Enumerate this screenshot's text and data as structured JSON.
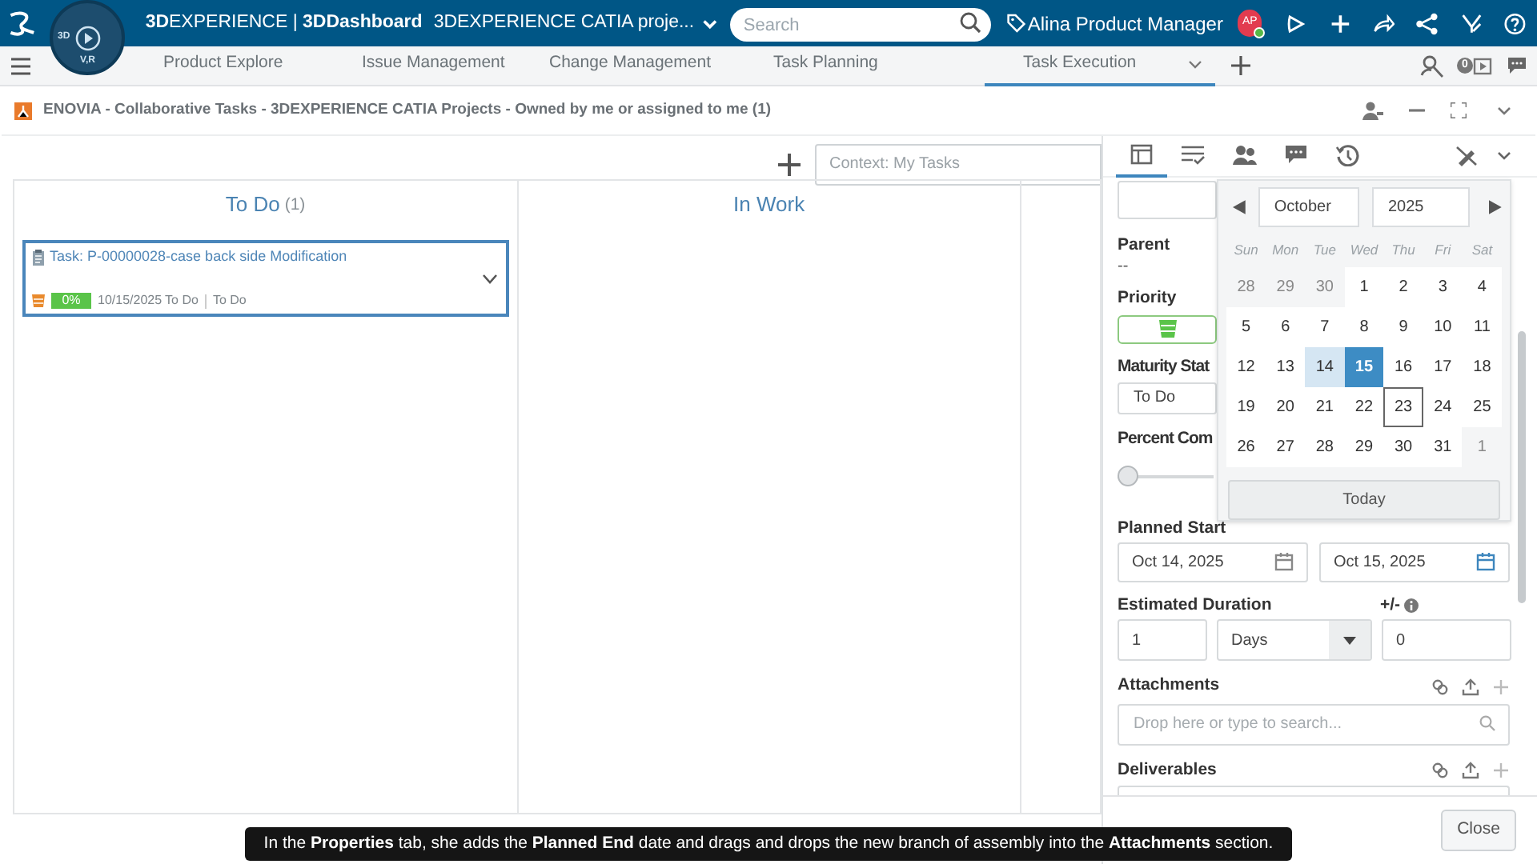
{
  "top_bar": {
    "compass_labels": [
      "3D",
      "V,R"
    ],
    "title": "**3D**EXPERIENCE | **3DDashboard**",
    "dashboard": "3DEXPERIENCE CATIA proje...",
    "search": {
      "placeholder": "Search"
    },
    "user": "Alina Product Manager",
    "avatar": "AP"
  },
  "tabs": [
    {
      "label": "Product Explore",
      "selected": false
    },
    {
      "label": "Issue Management",
      "selected": false
    },
    {
      "label": "Change Management",
      "selected": false
    },
    {
      "label": "Task Planning",
      "selected": false
    },
    {
      "label": "Task Execution",
      "selected": true
    }
  ],
  "notifications_count": "0",
  "widget_title": "ENOVIA - Collaborative Tasks - 3DEXPERIENCE CATIA Projects - Owned by me or assigned to me (1)",
  "context": {
    "placeholder": "Context: My Tasks"
  },
  "columns": [
    {
      "title": "To Do",
      "count": "(1)",
      "cards": [
        {
          "title": "Task: P-00000028-case back side Modification",
          "progress": "0%",
          "date": "10/15/2025",
          "state": "To Do",
          "state_2": "To Do"
        }
      ]
    },
    {
      "title": "In Work"
    }
  ],
  "panel": {
    "tabs": [
      {
        "kind": "properties",
        "selected": true
      },
      {
        "kind": "checklist",
        "selected": false
      },
      {
        "kind": "members",
        "selected": false
      },
      {
        "kind": "comments",
        "selected": false
      },
      {
        "kind": "history",
        "selected": false
      }
    ],
    "parent_label": "Parent",
    "parent_value": "--",
    "priority_label": "Priority",
    "maturity_label": "Maturity Stat",
    "maturity_value": "To Do",
    "percent_label": "Percent Com",
    "percent": {
      "level": 0
    },
    "planned_start_label": "Planned Start",
    "start_date": "Oct 14, 2025",
    "end_date": "Oct 15, 2025",
    "duration_label": "Estimated Duration",
    "tolerance_label": "+/-",
    "duration": "1",
    "unit": "Days",
    "tolerance": "0",
    "attachments_label": "Attachments",
    "attachments_placeholder": "Drop here or type to search...",
    "deliverables_label": "Deliverables",
    "close": "Close"
  },
  "calendar": {
    "month": "October",
    "year": "2025",
    "weekdays": [
      "Sun",
      "Mon",
      "Tue",
      "Wed",
      "Thu",
      "Fri",
      "Sat"
    ],
    "weeks": [
      [
        {
          "day": "28",
          "muted": true
        },
        {
          "day": "29",
          "muted": true
        },
        {
          "day": "30",
          "muted": true
        },
        {
          "day": "1"
        },
        {
          "day": "2"
        },
        {
          "day": "3"
        },
        {
          "day": "4"
        }
      ],
      [
        {
          "day": "5"
        },
        {
          "day": "6"
        },
        {
          "day": "7"
        },
        {
          "day": "8"
        },
        {
          "day": "9"
        },
        {
          "day": "10"
        },
        {
          "day": "11"
        }
      ],
      [
        {
          "day": "12"
        },
        {
          "day": "13"
        },
        {
          "day": "14",
          "in_range": true
        },
        {
          "day": "15",
          "selected": true
        },
        {
          "day": "16"
        },
        {
          "day": "17"
        },
        {
          "day": "18"
        }
      ],
      [
        {
          "day": "19"
        },
        {
          "day": "20"
        },
        {
          "day": "21"
        },
        {
          "day": "22"
        },
        {
          "day": "23",
          "hovered": true
        },
        {
          "day": "24"
        },
        {
          "day": "25"
        }
      ],
      [
        {
          "day": "26"
        },
        {
          "day": "27"
        },
        {
          "day": "28"
        },
        {
          "day": "29"
        },
        {
          "day": "30"
        },
        {
          "day": "31"
        },
        {
          "day": "1",
          "muted": true
        }
      ]
    ],
    "today": "Today"
  },
  "caption": "In the **Properties** tab, she adds the **Planned End** date and drags and drops the new branch of assembly into the **Attachments** section."
}
